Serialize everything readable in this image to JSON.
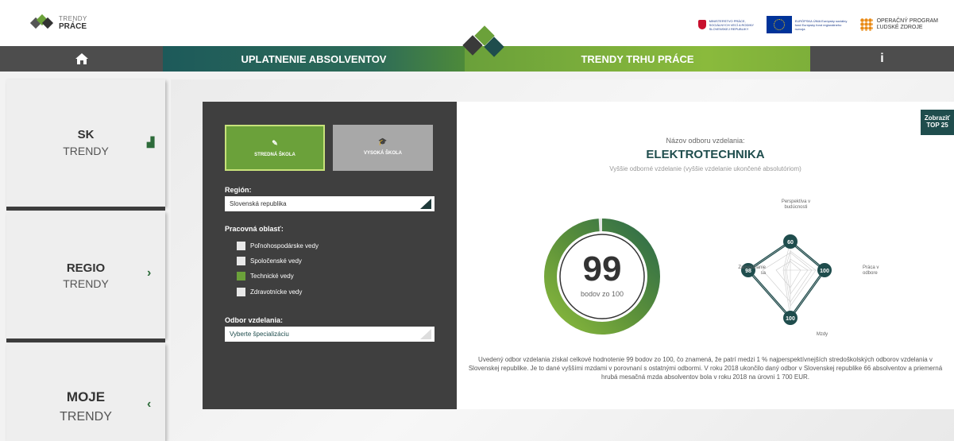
{
  "header": {
    "logo_line1": "TRENDY",
    "logo_line2": "PRÁCE",
    "partner1": "MINISTERSTVO PRÁCE, SOCIÁLNYCH VECÍ A RODINY SLOVENSKEJ REPUBLIKY",
    "partner2": "EURÓPSKA ÚNIA Európsky sociálny fond Európsky fond regionálneho rozvoja",
    "partner3_line1": "OPERAČNÝ PROGRAM",
    "partner3_line2": "ĽUDSKÉ ZDROJE"
  },
  "nav": {
    "home_icon": "home-icon",
    "uplatnenie": "UPLATNENIE ABSOLVENTOV",
    "trendy": "TRENDY TRHU PRÁCE",
    "info": "i"
  },
  "sidebar": {
    "items": [
      {
        "title": "SK",
        "subtitle": "TRENDY",
        "arrow": "▟"
      },
      {
        "title": "REGIO",
        "subtitle": "TRENDY",
        "arrow": "›"
      },
      {
        "title": "MOJE",
        "subtitle": "TRENDY",
        "arrow": "‹"
      }
    ]
  },
  "filters": {
    "school_buttons": [
      {
        "label": "STREDNÁ ŠKOLA",
        "icon": "graduate-icon",
        "active": true
      },
      {
        "label": "VYSOKÁ ŠKOLA",
        "icon": "mortarboard-icon",
        "active": false
      }
    ],
    "region_label": "Región:",
    "region_value": "Slovenská republika",
    "area_label": "Pracovná oblasť:",
    "areas": [
      {
        "label": "Poľnohospodárske vedy",
        "checked": false
      },
      {
        "label": "Spoločenské vedy",
        "checked": false
      },
      {
        "label": "Technické vedy",
        "checked": true
      },
      {
        "label": "Zdravotnícke vedy",
        "checked": false
      }
    ],
    "field_label": "Odbor vzdelania:",
    "field_placeholder": "Vyberte špecializáciu"
  },
  "detail": {
    "zobrazit_line1": "Zobraziť",
    "zobrazit_line2": "TOP 25",
    "name_label": "Názov odboru vzdelania:",
    "name_value": "ELEKTROTECHNIKA",
    "name_sub": "Vyššie odborné vzdelanie (vyššie vzdelanie ukončené absolutóriom)",
    "score": "99",
    "score_sub": "bodov zo 100",
    "score_fraction": 0.99,
    "radar": {
      "labels": {
        "top": "Perspektíva v budúcnosti",
        "right": "Práca v odbore",
        "bottom": "Mzdy",
        "left": "Zamestnanie sa"
      },
      "values": {
        "top": "60",
        "right": "100",
        "bottom": "100",
        "left": "98"
      }
    },
    "description": "Uvedený odbor vzdelania získal celkové hodnotenie 99 bodov zo 100, čo znamená, že patrí medzi 1 % najperspektívnejších stredoškolských odborov vzdelania v Slovenskej republike. Je to dané vyššími mzdami v porovnaní s ostatnými odbormi. V roku 2018 ukončilo daný odbor v Slovenskej republike 66 absolventov a priemerná hrubá mesačná mzda absolventov bola v roku 2018 na úrovni 1 700 EUR."
  },
  "colors": {
    "teal": "#1f4d4d",
    "green": "#6ba13a",
    "dark": "#3f3f3f"
  }
}
